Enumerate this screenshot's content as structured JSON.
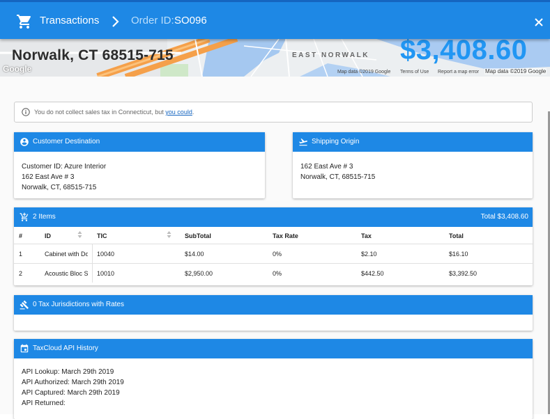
{
  "header": {
    "crumb_transactions": "Transactions",
    "order_label": "Order ID:",
    "order_id": "SO096",
    "colors": {
      "bar": "#1e88e5"
    }
  },
  "map": {
    "address": "Norwalk, CT 68515-715",
    "total": "$3,408.60",
    "neighborhood": "EAST NORWALK",
    "logo": "Google",
    "credit1": "Map data ©2019 Google",
    "terms": "Terms of Use",
    "report": "Report a map error",
    "credit2": "Map data ©2019 Google"
  },
  "notice": {
    "text": "You do not collect sales tax in Connecticut, but ",
    "link": "you could",
    "tail": "."
  },
  "destination": {
    "title": "Customer Destination",
    "lines": [
      "Customer ID: Azure Interior",
      "162 East Ave # 3",
      "Norwalk, CT, 68515-715"
    ]
  },
  "origin": {
    "title": "Shipping Origin",
    "lines": [
      "162 East Ave # 3",
      "Norwalk, CT, 68515-715"
    ]
  },
  "items": {
    "title": "2 Items",
    "total": "Total $3,408.60",
    "columns": [
      "#",
      "ID",
      "TIC",
      "SubTotal",
      "Tax Rate",
      "Tax",
      "Total"
    ],
    "rows": [
      [
        "1",
        "Cabinet with Doors",
        "10040",
        "$14.00",
        "0%",
        "$2.10",
        "$16.10"
      ],
      [
        "2",
        "Acoustic Bloc Screens",
        "10010",
        "$2,950.00",
        "0%",
        "$442.50",
        "$3,392.50"
      ]
    ]
  },
  "jurisdictions": {
    "title": "0 Tax Jurisdictions with Rates"
  },
  "history": {
    "title": "TaxCloud API History",
    "lines": [
      "API Lookup: March 29th 2019",
      "API Authorized: March 29th 2019",
      "API Captured: March 29th 2019",
      "API Returned:"
    ]
  }
}
